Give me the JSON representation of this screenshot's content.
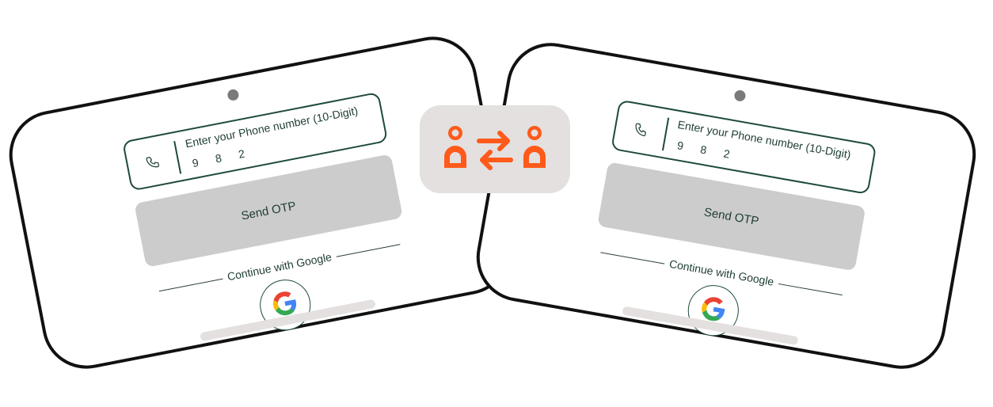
{
  "left_device": {
    "phone_field": {
      "label": "Enter your Phone number (10-Digit)",
      "value": "9 8 2"
    },
    "send_otp_label": "Send OTP",
    "divider_text": "Continue with Google"
  },
  "right_device": {
    "phone_field": {
      "label": "Enter your Phone number (10-Digit)",
      "value": "9 8 2"
    },
    "send_otp_label": "Send OTP",
    "divider_text": "Continue with Google"
  },
  "swap_badge": {
    "icons": [
      "user-icon",
      "swap-arrows-icon",
      "user-icon"
    ]
  },
  "colors": {
    "accent": "#ff5a1a",
    "outline": "#1e4a3c",
    "button_bg": "#cccccc",
    "badge_bg": "#e3e0df",
    "device_border": "#111111"
  }
}
